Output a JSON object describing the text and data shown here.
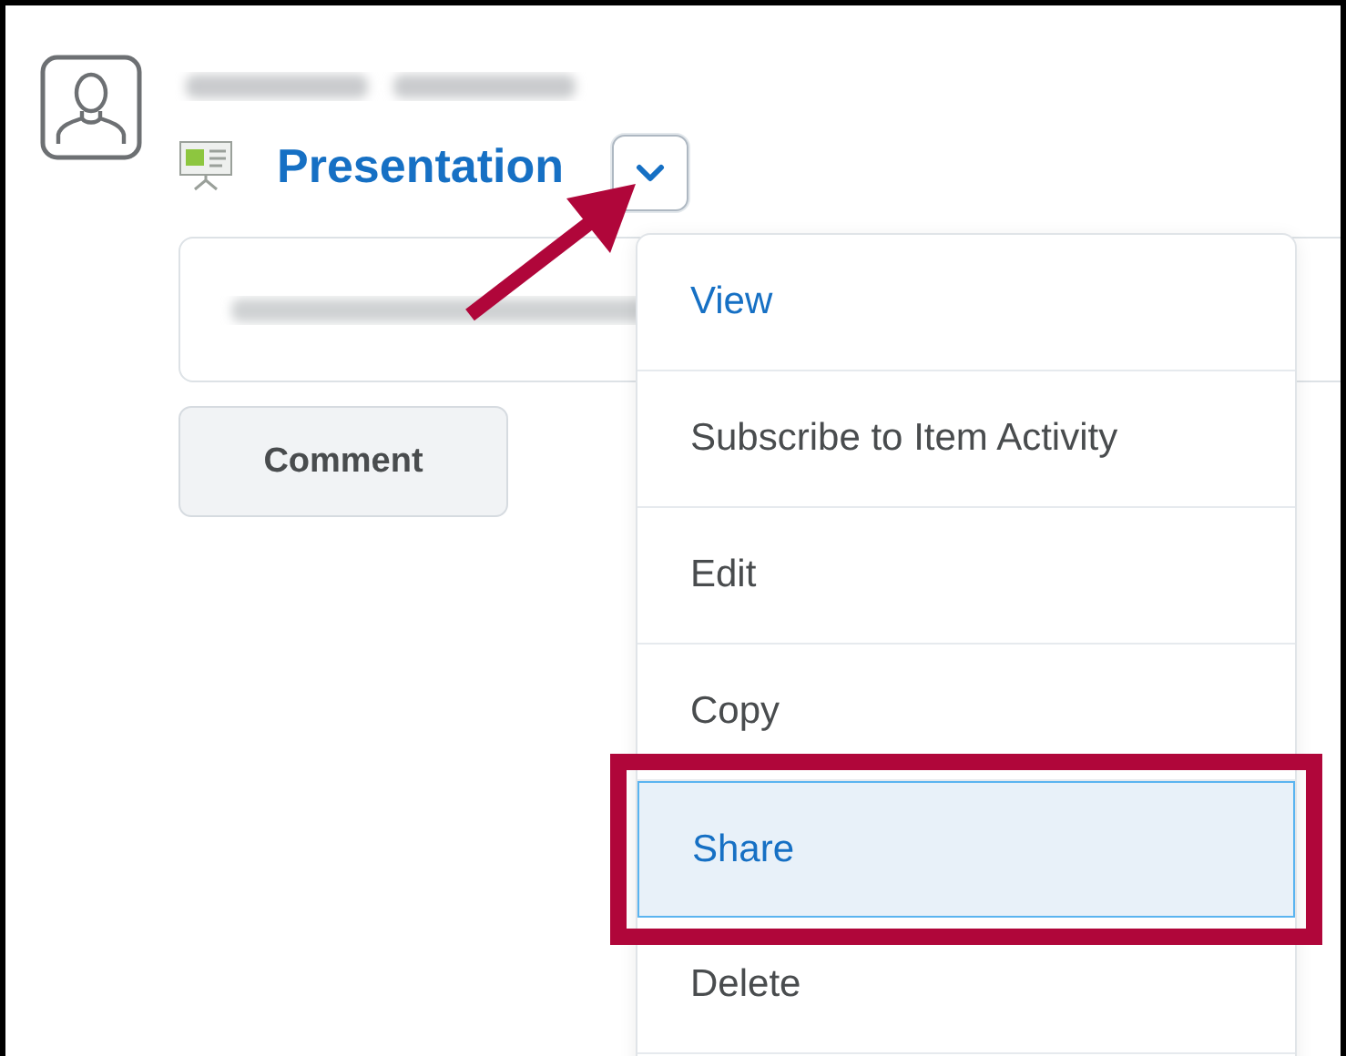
{
  "post": {
    "title": "Presentation"
  },
  "menu_button": {
    "expanded": true
  },
  "comment_button": "Comment",
  "menu": {
    "items": [
      {
        "label": "View",
        "kind": "link",
        "selected": false,
        "callout": false
      },
      {
        "label": "Subscribe to Item Activity",
        "kind": "action",
        "selected": false,
        "callout": false
      },
      {
        "label": "Edit",
        "kind": "action",
        "selected": false,
        "callout": false
      },
      {
        "label": "Copy",
        "kind": "action",
        "selected": false,
        "callout": false
      },
      {
        "label": "Share",
        "kind": "action",
        "selected": true,
        "callout": true
      },
      {
        "label": "Delete",
        "kind": "action",
        "selected": false,
        "callout": false
      }
    ]
  }
}
